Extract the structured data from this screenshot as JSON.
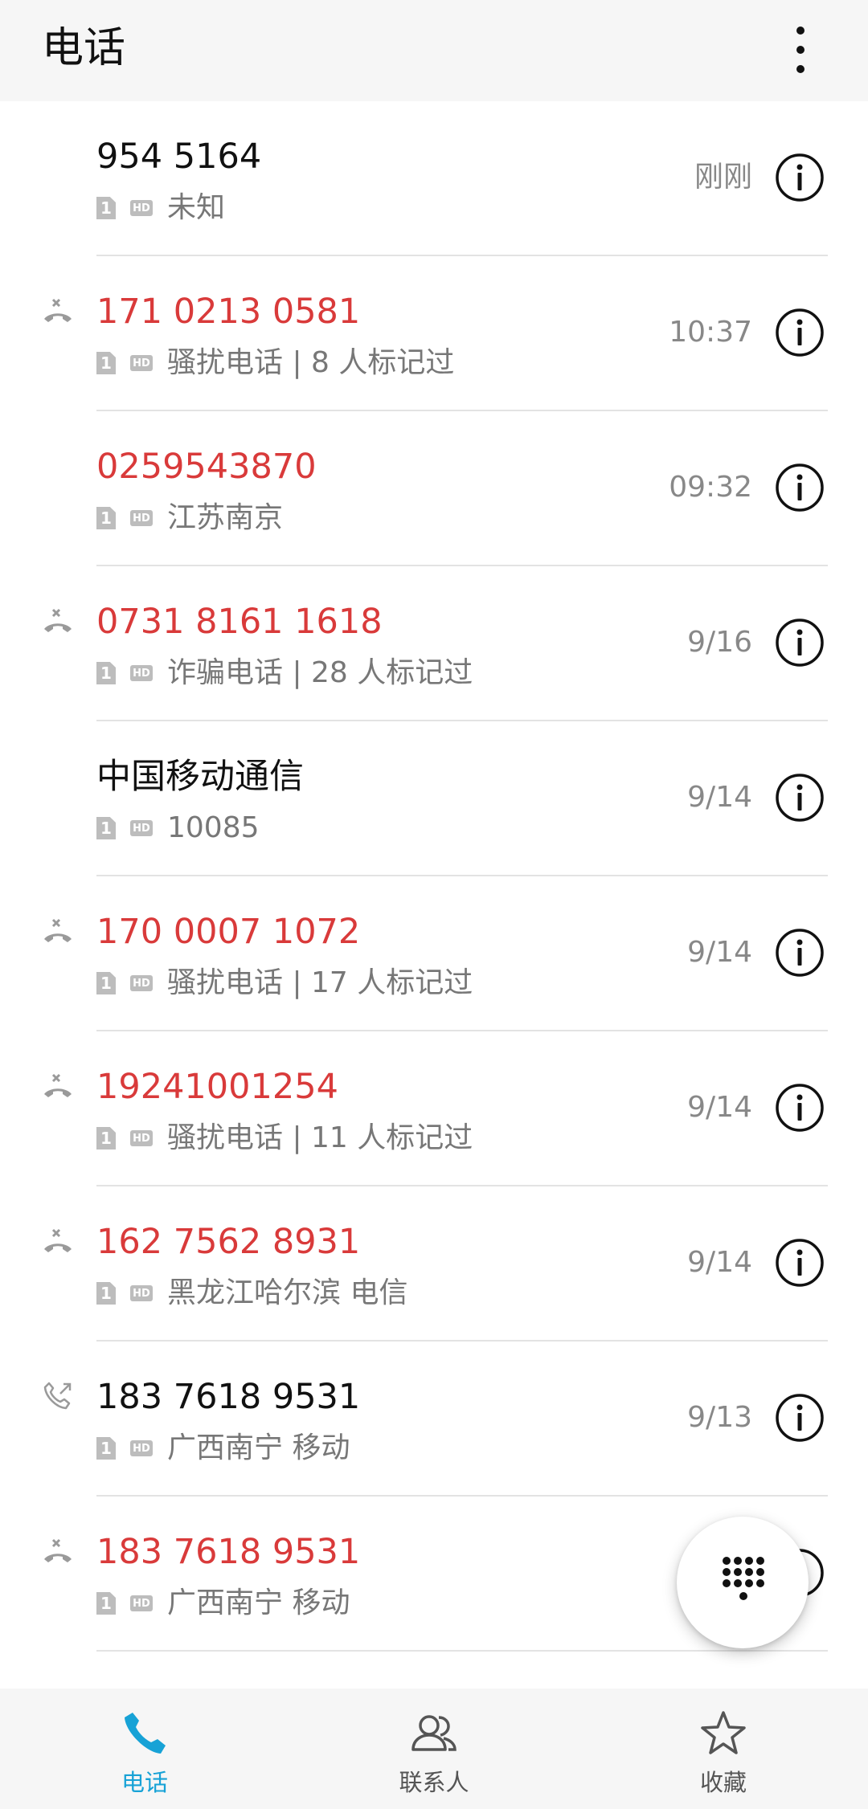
{
  "header": {
    "title": "电话"
  },
  "calls": [
    {
      "name": "954 5164",
      "spam": false,
      "sim": "1",
      "hd": "HD",
      "detail": "未知",
      "time": "刚刚",
      "type": "none"
    },
    {
      "name": "171 0213 0581",
      "spam": true,
      "sim": "1",
      "hd": "HD",
      "detail": "骚扰电话 | 8 人标记过",
      "time": "10:37",
      "type": "rejected"
    },
    {
      "name": "0259543870",
      "spam": true,
      "sim": "1",
      "hd": "HD",
      "detail": "江苏南京",
      "time": "09:32",
      "type": "none"
    },
    {
      "name": "0731 8161 1618",
      "spam": true,
      "sim": "1",
      "hd": "HD",
      "detail": "诈骗电话 | 28 人标记过",
      "time": "9/16",
      "type": "rejected"
    },
    {
      "name": "中国移动通信",
      "spam": false,
      "sim": "1",
      "hd": "HD",
      "detail": "10085",
      "time": "9/14",
      "type": "none"
    },
    {
      "name": "170 0007 1072",
      "spam": true,
      "sim": "1",
      "hd": "HD",
      "detail": "骚扰电话 | 17 人标记过",
      "time": "9/14",
      "type": "rejected"
    },
    {
      "name": "19241001254",
      "spam": true,
      "sim": "1",
      "hd": "HD",
      "detail": "骚扰电话 | 11 人标记过",
      "time": "9/14",
      "type": "rejected"
    },
    {
      "name": "162 7562 8931",
      "spam": true,
      "sim": "1",
      "hd": "HD",
      "detail": "黑龙江哈尔滨 电信",
      "time": "9/14",
      "type": "rejected"
    },
    {
      "name": "183 7618 9531",
      "spam": false,
      "sim": "1",
      "hd": "HD",
      "detail": "广西南宁 移动",
      "time": "9/13",
      "type": "outgoing"
    },
    {
      "name": "183 7618 9531",
      "spam": true,
      "sim": "1",
      "hd": "HD",
      "detail": "广西南宁 移动",
      "time": "",
      "type": "rejected"
    }
  ],
  "tabs": [
    {
      "label": "电话",
      "icon": "phone-icon",
      "active": true
    },
    {
      "label": "联系人",
      "icon": "contacts-icon",
      "active": false
    },
    {
      "label": "收藏",
      "icon": "star-icon",
      "active": false
    }
  ],
  "colors": {
    "spam": "#d93a3a",
    "accent": "#17a2d6",
    "normal": "#111111"
  }
}
